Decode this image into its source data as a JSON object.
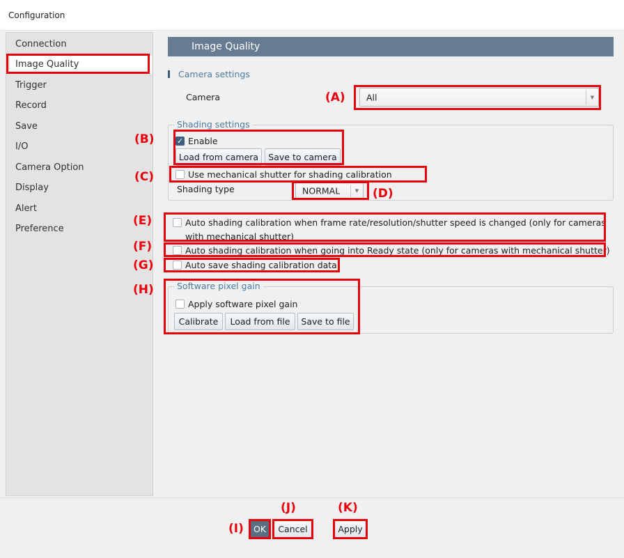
{
  "window": {
    "title": "Configuration"
  },
  "sidebar": {
    "items": [
      {
        "label": "Connection",
        "selected": false
      },
      {
        "label": "Image Quality",
        "selected": true
      },
      {
        "label": "Trigger",
        "selected": false
      },
      {
        "label": "Record",
        "selected": false
      },
      {
        "label": "Save",
        "selected": false
      },
      {
        "label": "I/O",
        "selected": false
      },
      {
        "label": "Camera Option",
        "selected": false
      },
      {
        "label": "Display",
        "selected": false
      },
      {
        "label": "Alert",
        "selected": false
      },
      {
        "label": "Preference",
        "selected": false
      }
    ]
  },
  "main": {
    "header": "Image Quality",
    "camera_settings": {
      "section_label": "Camera settings",
      "camera_label": "Camera",
      "camera_value": "All"
    },
    "shading": {
      "group_label": "Shading settings",
      "enable_label": "Enable",
      "enable_checked": true,
      "load_button": "Load from camera",
      "save_button": "Save to camera",
      "mech_shutter_label": "Use mechanical shutter for shading calibration",
      "mech_shutter_checked": false,
      "type_label": "Shading type",
      "type_value": "NORMAL"
    },
    "auto_options": {
      "auto_calib_change_line1": "Auto shading calibration when frame rate/resolution/shutter speed is changed (only for cameras",
      "auto_calib_change_line2": "with mechanical shutter)",
      "auto_calib_ready": "Auto shading calibration when going into Ready state (only for cameras with mechanical shutter)",
      "auto_save": "Auto save shading calibration data"
    },
    "pixel_gain": {
      "group_label": "Software pixel gain",
      "apply_label": "Apply software pixel gain",
      "calibrate_button": "Calibrate",
      "load_button": "Load from file",
      "save_button": "Save to file"
    }
  },
  "footer": {
    "ok": "OK",
    "cancel": "Cancel",
    "apply": "Apply"
  },
  "annotations": {
    "A": "(A)",
    "B": "(B)",
    "C": "(C)",
    "D": "(D)",
    "E": "(E)",
    "F": "(F)",
    "G": "(G)",
    "H": "(H)",
    "I": "(I)",
    "J": "(J)",
    "K": "(K)"
  },
  "colors": {
    "header_bg": "#677c92",
    "accent_text": "#4e7b9e",
    "highlight": "#e8000b",
    "primary_button": "#5b6d80"
  }
}
